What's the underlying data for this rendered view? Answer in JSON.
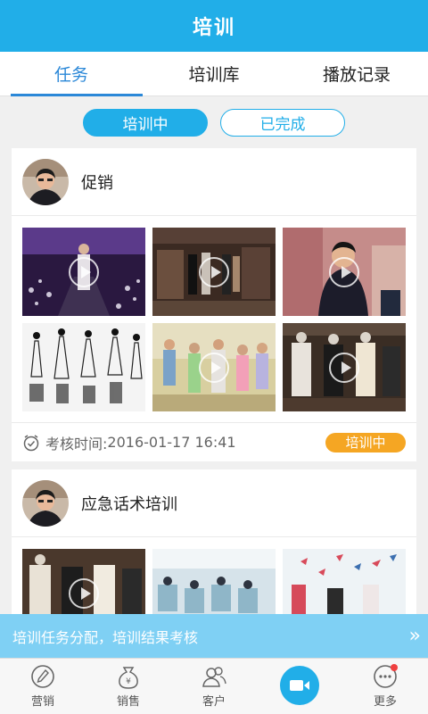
{
  "header": {
    "title": "培训"
  },
  "tabs": [
    {
      "label": "任务"
    },
    {
      "label": "培训库"
    },
    {
      "label": "播放记录"
    }
  ],
  "segment": {
    "active": "培训中",
    "inactive": "已完成"
  },
  "cards": [
    {
      "title": "促销",
      "exam_label": "考核时间:",
      "exam_time": "2016-01-17 16:41",
      "status": "培训中"
    },
    {
      "title": "应急话术培训"
    }
  ],
  "banner": {
    "text": "培训任务分配，培训结果考核",
    "chevron": "»"
  },
  "bottom_nav": [
    {
      "label": "营销",
      "icon": "pen-icon"
    },
    {
      "label": "销售",
      "icon": "money-bag-icon"
    },
    {
      "label": "客户",
      "icon": "users-icon"
    },
    {
      "label": "",
      "icon": "video-camera-icon"
    },
    {
      "label": "更多",
      "icon": "more-icon"
    }
  ],
  "colors": {
    "primary": "#21aee8",
    "tab_active": "#2b88d8",
    "badge": "#f5a623"
  }
}
